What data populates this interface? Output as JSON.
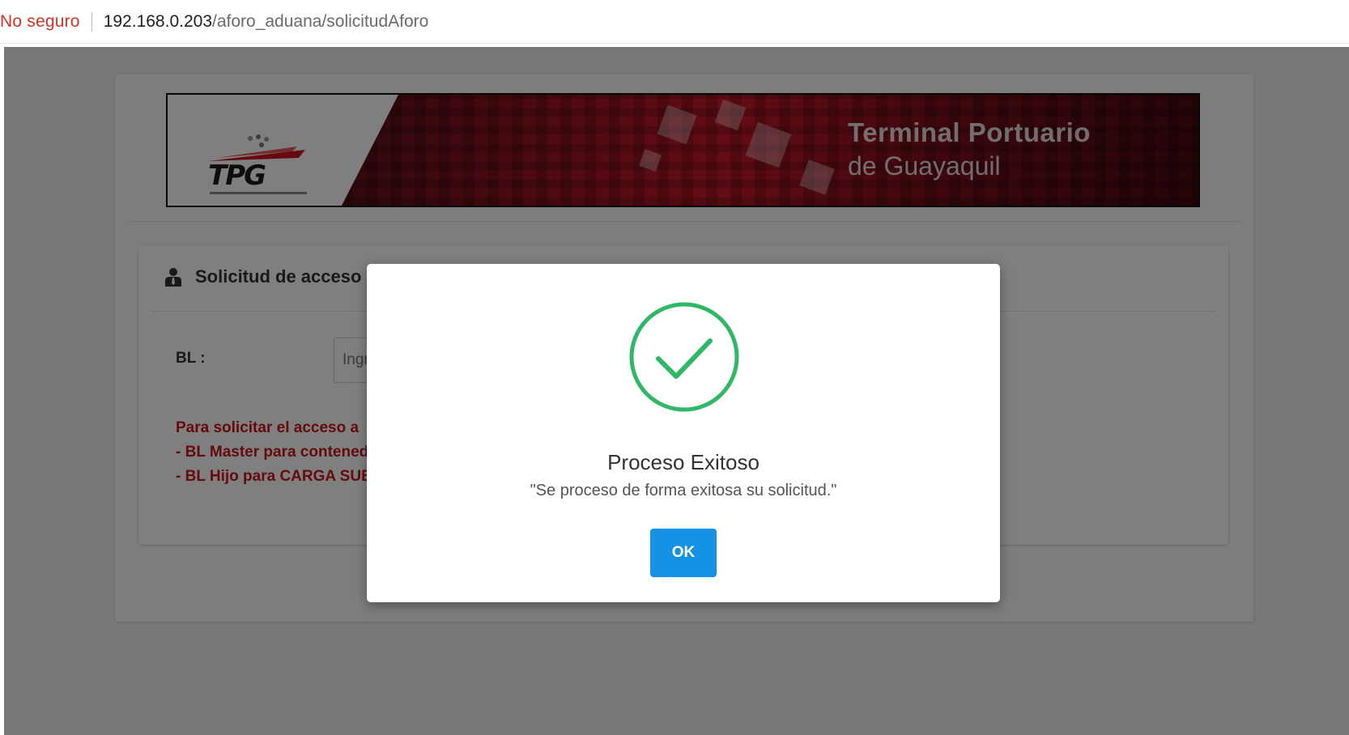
{
  "browser": {
    "security_label": "No seguro",
    "url_host": "192.168.0.203",
    "url_path": "/aforo_aduana/solicitudAforo"
  },
  "banner": {
    "logo_text": "TPG",
    "title_line1": "Terminal Portuario",
    "title_line2": "de Guayaquil"
  },
  "form": {
    "header_icon": "user-tie-icon",
    "title": "Solicitud de acceso",
    "bl_label": "BL :",
    "bl_placeholder": "Ingrese BL",
    "notes": [
      "Para solicitar el acceso a",
      "- BL Master para contenedores",
      "- BL Hijo para CARGA SUELTA"
    ]
  },
  "modal": {
    "icon": "check-circle-icon",
    "title": "Proceso Exitoso",
    "message": "\"Se proceso de forma exitosa su solicitud.\"",
    "ok_label": "OK"
  },
  "colors": {
    "success": "#2fb866",
    "button": "#1592e6",
    "note_red": "#c9161d",
    "insecure": "#d93025"
  }
}
